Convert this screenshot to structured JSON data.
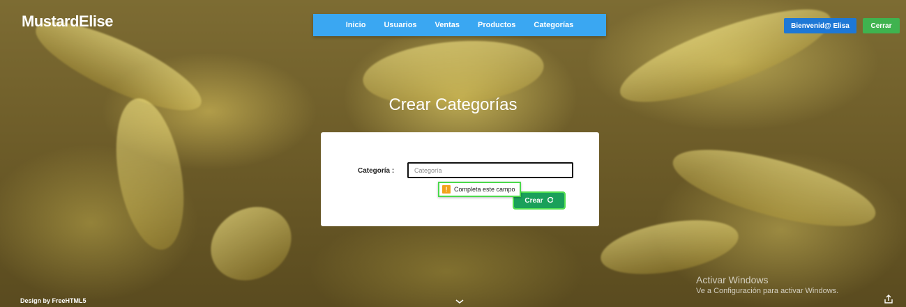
{
  "brand": "MustardElise",
  "nav": {
    "items": [
      "Inicio",
      "Usuarios",
      "Ventas",
      "Productos",
      "Categorías"
    ]
  },
  "header_buttons": {
    "welcome": "Bienvenid@ Elisa",
    "close": "Cerrar"
  },
  "page_title": "Crear Categorías",
  "form": {
    "label": "Categoría  :",
    "input_placeholder": "Categoría",
    "input_value": "",
    "submit_label": "Crear"
  },
  "validation_tooltip": {
    "message": "Completa este campo",
    "icon": "warning-icon"
  },
  "footer": {
    "credit": "Design by FreeHTML5"
  },
  "windows_watermark": {
    "title": "Activar Windows",
    "subtitle": "Ve a Configuración para activar Windows."
  },
  "colors": {
    "nav_bg": "#3aa7f2",
    "welcome_bg": "#1e78d6",
    "close_bg": "#3fb34f",
    "create_bg": "#1aa05a",
    "warning": "#f2a21b"
  }
}
